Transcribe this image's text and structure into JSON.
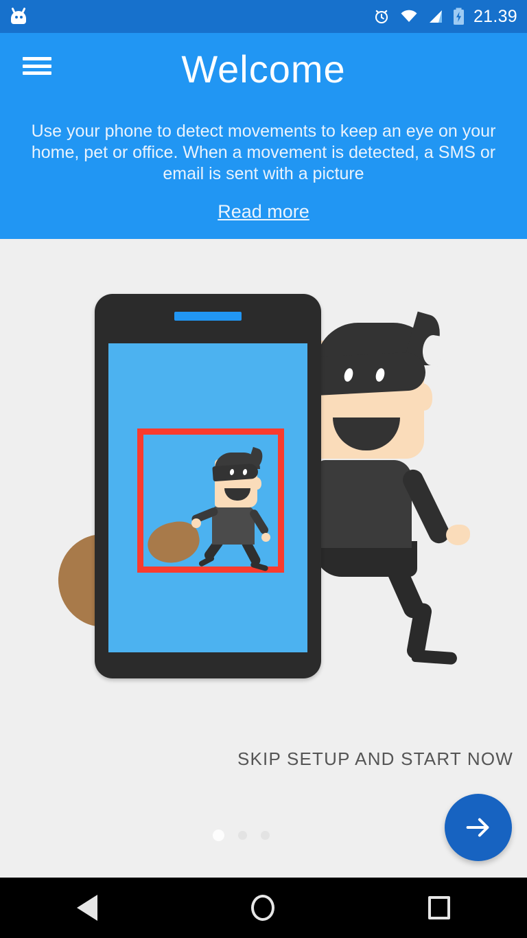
{
  "status_bar": {
    "app_icon": "android-head-icon",
    "icons": [
      "alarm-icon",
      "wifi-icon",
      "signal-icon",
      "battery-charging-icon"
    ],
    "time": "21.39",
    "background_color": "#1771cc"
  },
  "header": {
    "menu_icon": "hamburger-menu-icon",
    "title": "Welcome",
    "description": "Use your phone to detect movements to keep an eye on your home, pet or office. When a movement is detected, a SMS or email is sent with a picture",
    "read_more_label": "Read more",
    "background_color": "#2196f3"
  },
  "illustration": {
    "name": "burglar-detection-illustration",
    "phone_screen_color": "#4cb2f0",
    "detection_box_color": "#fa3b2e",
    "sack_color": "#a87a4a",
    "thief_mask_color": "#333333",
    "skin_color": "#fadcba"
  },
  "footer": {
    "skip_label": "SKIP SETUP AND START NOW",
    "page_indicator": {
      "total": 3,
      "active_index": 0
    },
    "next_button": {
      "icon": "arrow-right-icon",
      "color": "#1763c1"
    }
  },
  "nav_bar": {
    "back": "back-triangle-icon",
    "home": "home-circle-icon",
    "recents": "recents-square-icon",
    "background_color": "#000000"
  }
}
